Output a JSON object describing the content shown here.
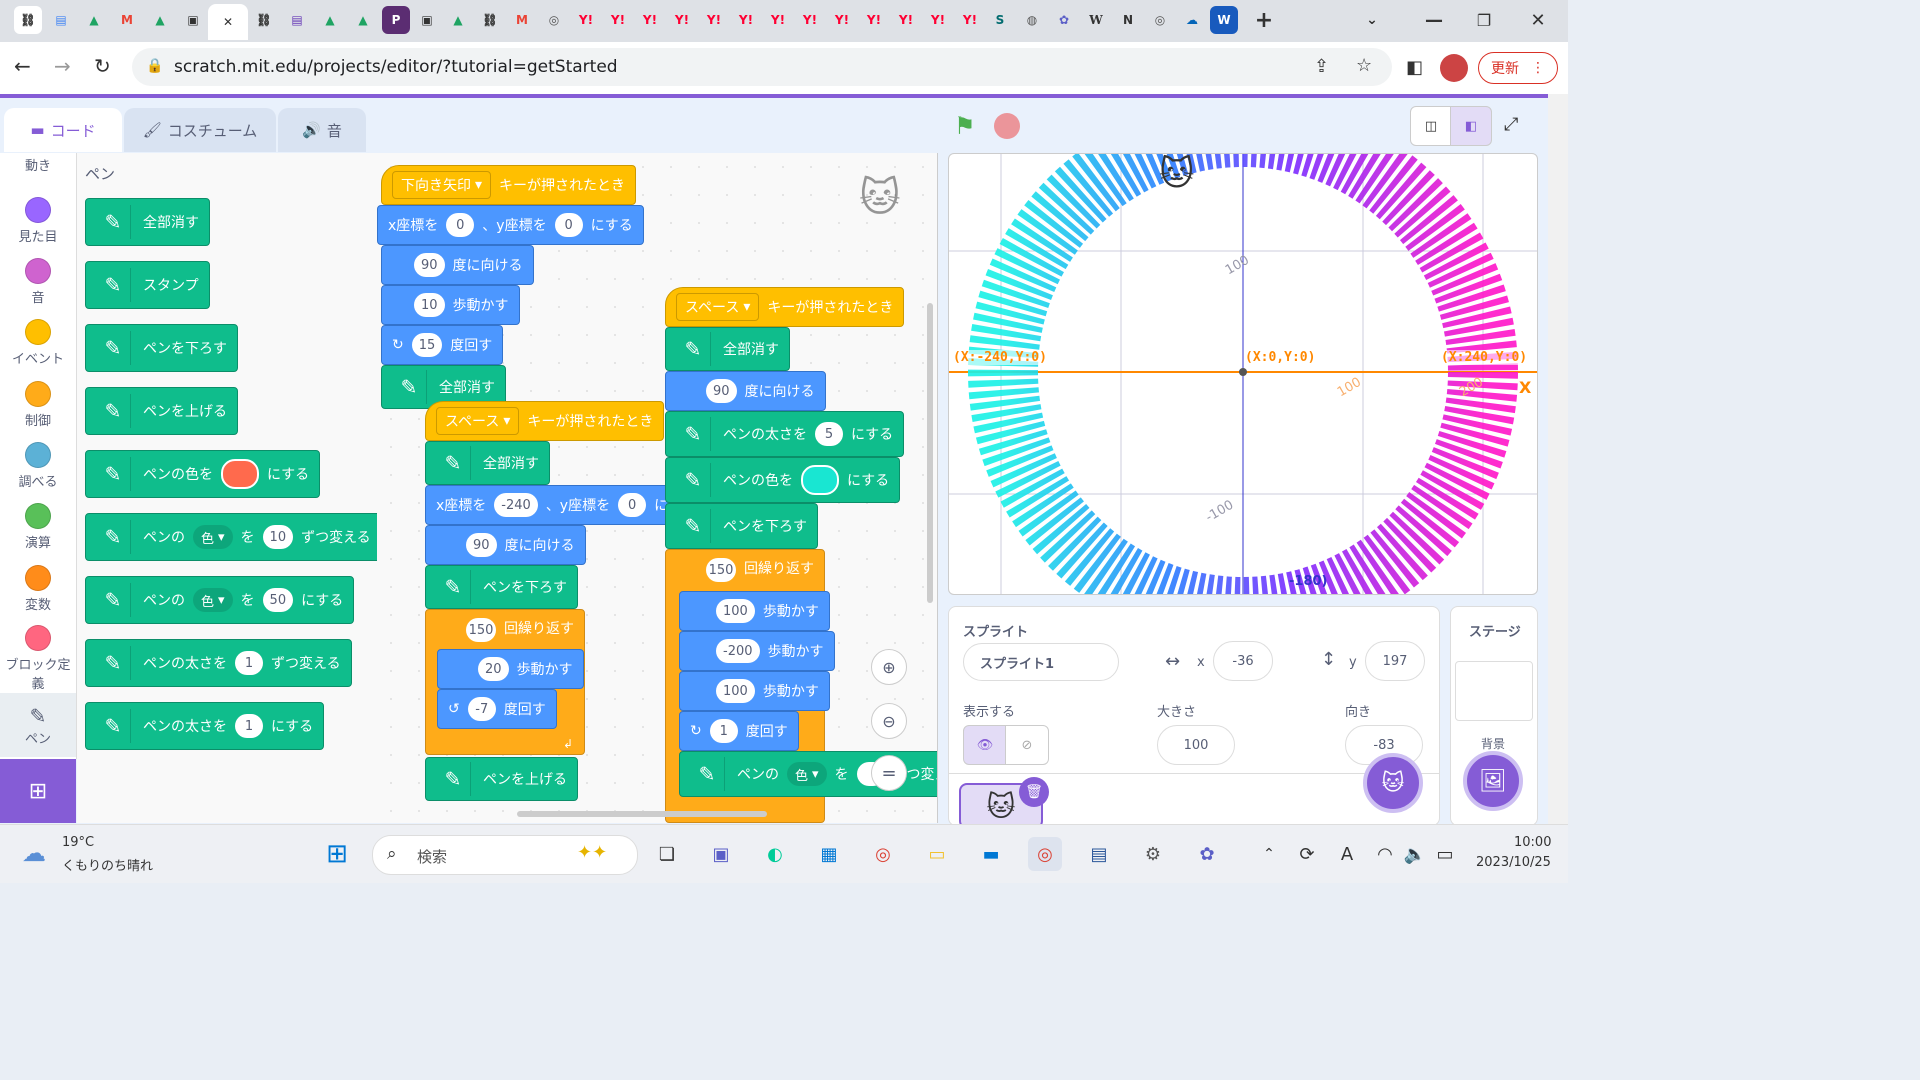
{
  "browser": {
    "url": "scratch.mit.edu/projects/editor/?tutorial=getStarted",
    "update_label": "更新",
    "new_tab": "+",
    "tab_icons": [
      "link",
      "docs",
      "drive",
      "gmail",
      "drive",
      "contacts",
      "active-close",
      "link",
      "forms",
      "drive",
      "drive",
      "p",
      "contacts",
      "drive",
      "link",
      "gmail",
      "chrome",
      "Y!",
      "Y!",
      "Y!",
      "Y!",
      "Y!",
      "Y!",
      "Y!",
      "Y!",
      "Y!",
      "Y!",
      "Y!",
      "Y!",
      "sharepoint",
      "globe",
      "copilot",
      "W",
      "N",
      "chrome",
      "onedrive",
      "word"
    ]
  },
  "editor_tabs": {
    "code": "コード",
    "costume": "コスチューム",
    "sound": "音"
  },
  "categories": [
    {
      "label": "動き",
      "color": "#4c97ff"
    },
    {
      "label": "見た目",
      "color": "#9966ff"
    },
    {
      "label": "音",
      "color": "#cf63cf"
    },
    {
      "label": "イベント",
      "color": "#ffbf00"
    },
    {
      "label": "制御",
      "color": "#ffab19"
    },
    {
      "label": "調べる",
      "color": "#5cb1d6"
    },
    {
      "label": "演算",
      "color": "#59c059"
    },
    {
      "label": "変数",
      "color": "#ff8c1a"
    },
    {
      "label": "ブロック定義",
      "color": "#ff6680"
    },
    {
      "label": "ペン",
      "color": "#0fbd8c"
    }
  ],
  "palette": {
    "heading": "ペン",
    "blocks": {
      "clear": "全部消す",
      "stamp": "スタンプ",
      "pen_down": "ペンを下ろす",
      "pen_up": "ペンを上げる",
      "set_color_a": "ペンの色を",
      "set_color_b": "にする",
      "change_param_a": "ペンの",
      "change_param_dd": "色",
      "change_param_b": "を",
      "change_param_val": "10",
      "change_param_c": "ずつ変える",
      "set_param_a": "ペンの",
      "set_param_dd": "色",
      "set_param_b": "を",
      "set_param_val": "50",
      "set_param_c": "にする",
      "change_size_a": "ペンの太さを",
      "change_size_val": "1",
      "change_size_b": "ずつ変える",
      "set_size_a": "ペンの太さを",
      "set_size_val": "1",
      "set_size_b": "にする"
    }
  },
  "script1": {
    "hat_key": "下向き矢印",
    "hat_text": "キーが押されたとき",
    "goto_a": "x座標を",
    "goto_x": "0",
    "goto_b": "、y座標を",
    "goto_y": "0",
    "goto_c": "にする",
    "point_val": "90",
    "point_text": "度に向ける",
    "move_val": "10",
    "move_text": "歩動かす",
    "turn_val": "15",
    "turn_text": "度回す",
    "clear_partial": "全部消す"
  },
  "script2": {
    "hat_key": "スペース",
    "hat_text": "キーが押されたとき",
    "clear": "全部消す",
    "goto_a": "x座標を",
    "goto_x": "-240",
    "goto_b": "、y座標を",
    "goto_y": "0",
    "goto_c": "にす",
    "point_val": "90",
    "point_text": "度に向ける",
    "pen_down": "ペンを下ろす",
    "repeat_val": "150",
    "repeat_text": "回繰り返す",
    "move_val": "20",
    "move_text": "歩動かす",
    "turn_val": "-7",
    "turn_text": "度回す",
    "pen_up": "ペンを上げる"
  },
  "script3": {
    "hat_key": "スペース",
    "hat_text": "キーが押されたとき",
    "clear": "全部消す",
    "point_val": "90",
    "point_text": "度に向ける",
    "size_a": "ペンの太さを",
    "size_val": "5",
    "size_b": "にする",
    "color_a": "ペンの色を",
    "color_b": "にする",
    "pen_down": "ペンを下ろす",
    "repeat_val": "150",
    "repeat_text": "回繰り返す",
    "move1_val": "100",
    "move1_text": "歩動かす",
    "move2_val": "-200",
    "move2_text": "歩動かす",
    "move3_val": "100",
    "move3_text": "歩動かす",
    "turn_val": "1",
    "turn_text": "度回す",
    "change_a": "ペンの",
    "change_dd": "色",
    "change_b": "を",
    "change_c": "ずつ変え"
  },
  "stage": {
    "label_left": "(X:-240,Y:0)",
    "label_center": "(X:0,Y:0)",
    "label_right": "(X:240,Y:0)",
    "label_x": "X",
    "label_bottom": "-180)",
    "tick_100a": "100",
    "tick_100b": "100",
    "tick_200": "200",
    "tick_m100": "-100"
  },
  "sprite_info": {
    "title": "スプライト",
    "name": "スプライト1",
    "x_label": "x",
    "x": "-36",
    "y_label": "y",
    "y": "197",
    "show_label": "表示する",
    "size_label": "大きさ",
    "size": "100",
    "direction_label": "向き",
    "direction": "-83"
  },
  "stage_pane": {
    "title": "ステージ",
    "backdrop_label": "背景"
  },
  "taskbar": {
    "temp": "19°C",
    "weather": "くもりのち晴れ",
    "search": "検索",
    "time": "10:00",
    "date": "2023/10/25"
  },
  "colors": {
    "pen": "#0fbd8c",
    "motion": "#4c97ff",
    "events": "#ffbf00",
    "control": "#ffab19",
    "scratch_purple": "#855cd6",
    "pen_color_palette": "#ff6a4d",
    "pen_color_script": "#19e6d2"
  }
}
